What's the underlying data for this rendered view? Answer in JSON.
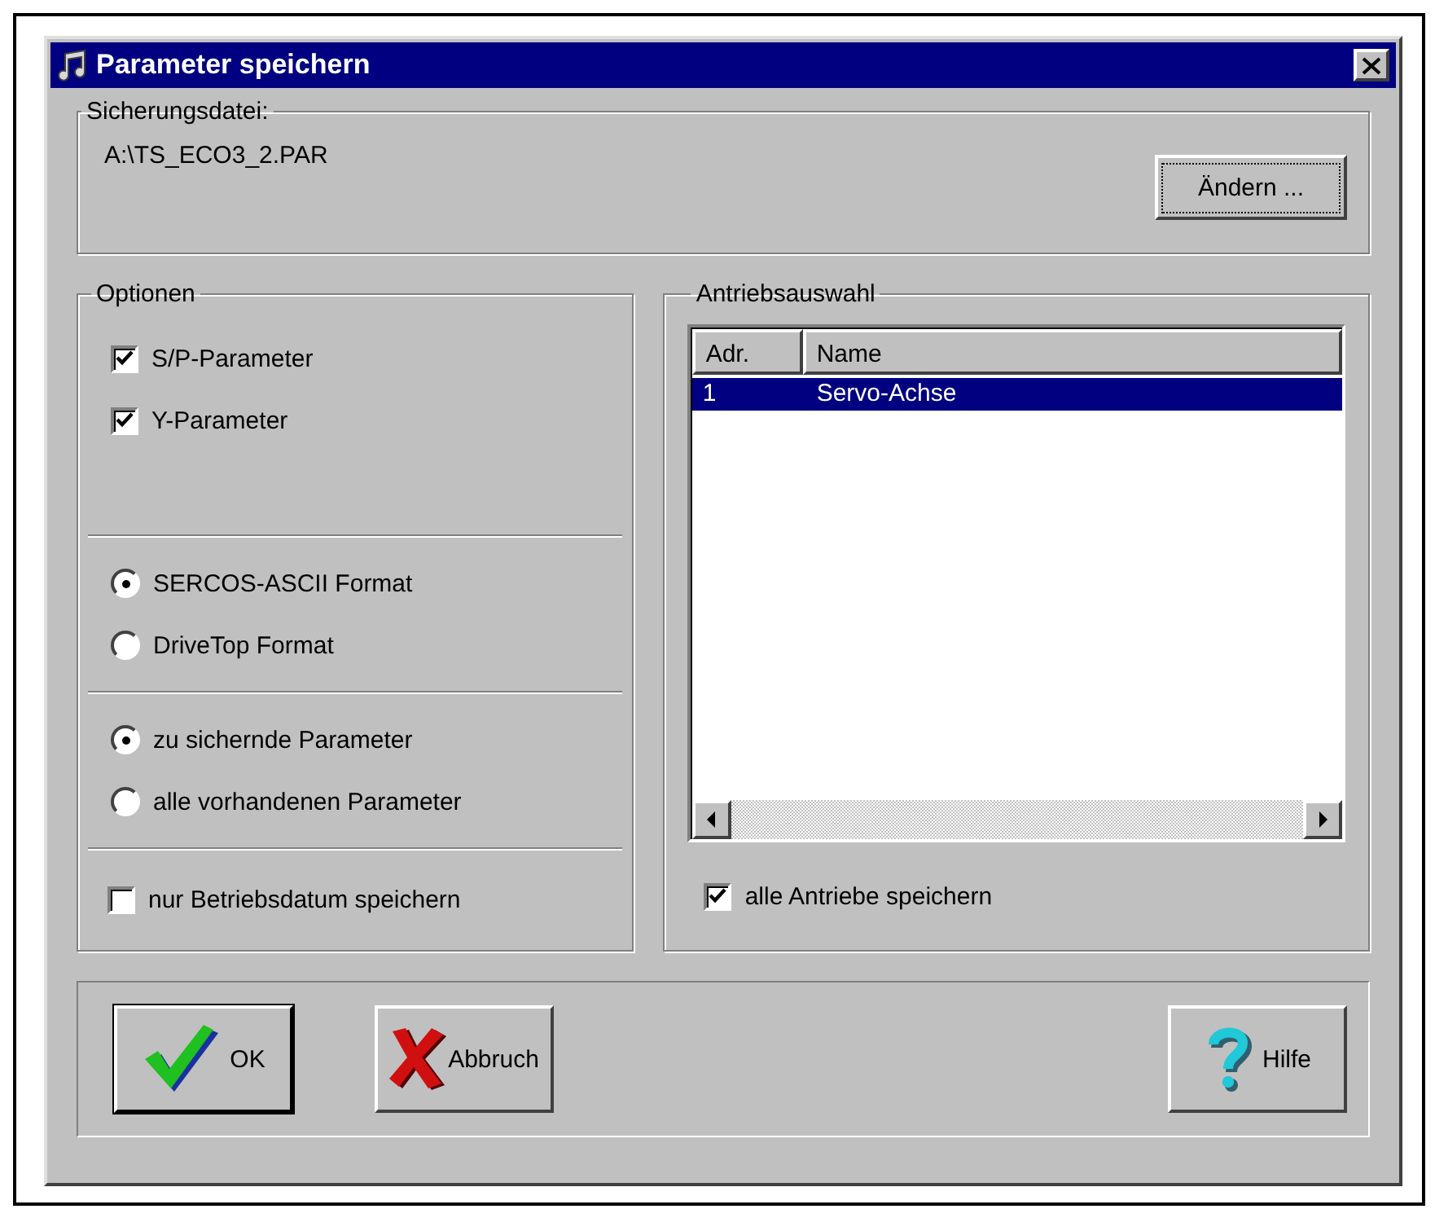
{
  "window": {
    "title": "Parameter speichern"
  },
  "backup_file": {
    "label": "Sicherungsdatei:",
    "path": "A:\\TS_ECO3_2.PAR",
    "change_button": {
      "label": "Ändern ...",
      "focused": true
    }
  },
  "options": {
    "label": "Optionen",
    "sections": [
      {
        "items": [
          {
            "kind": "checkbox",
            "label": "S/P-Parameter",
            "checked": true
          },
          {
            "kind": "checkbox",
            "label": "Y-Parameter",
            "checked": true
          }
        ]
      },
      {
        "items": [
          {
            "kind": "radio",
            "label": "SERCOS-ASCII Format",
            "selected": true
          },
          {
            "kind": "radio",
            "label": "DriveTop Format",
            "selected": false
          }
        ]
      },
      {
        "items": [
          {
            "kind": "radio",
            "label": "zu sichernde Parameter",
            "selected": true
          },
          {
            "kind": "radio",
            "label": "alle vorhandenen Parameter",
            "selected": false
          }
        ]
      },
      {
        "items": [
          {
            "kind": "checkbox",
            "label": "nur Betriebsdatum speichern",
            "checked": false
          }
        ]
      }
    ]
  },
  "drives": {
    "label": "Antriebsauswahl",
    "columns": [
      "Adr.",
      "Name"
    ],
    "rows": [
      {
        "cells": [
          "1",
          "Servo-Achse"
        ],
        "selected": true
      }
    ],
    "all_drives": {
      "label": "alle Antriebe speichern",
      "checked": true
    }
  },
  "buttons": [
    {
      "kind": "ok",
      "label": "OK",
      "default": true
    },
    {
      "kind": "cancel",
      "label": "Abbruch",
      "default": false
    },
    {
      "kind": "help",
      "label": "Hilfe",
      "default": false
    }
  ]
}
